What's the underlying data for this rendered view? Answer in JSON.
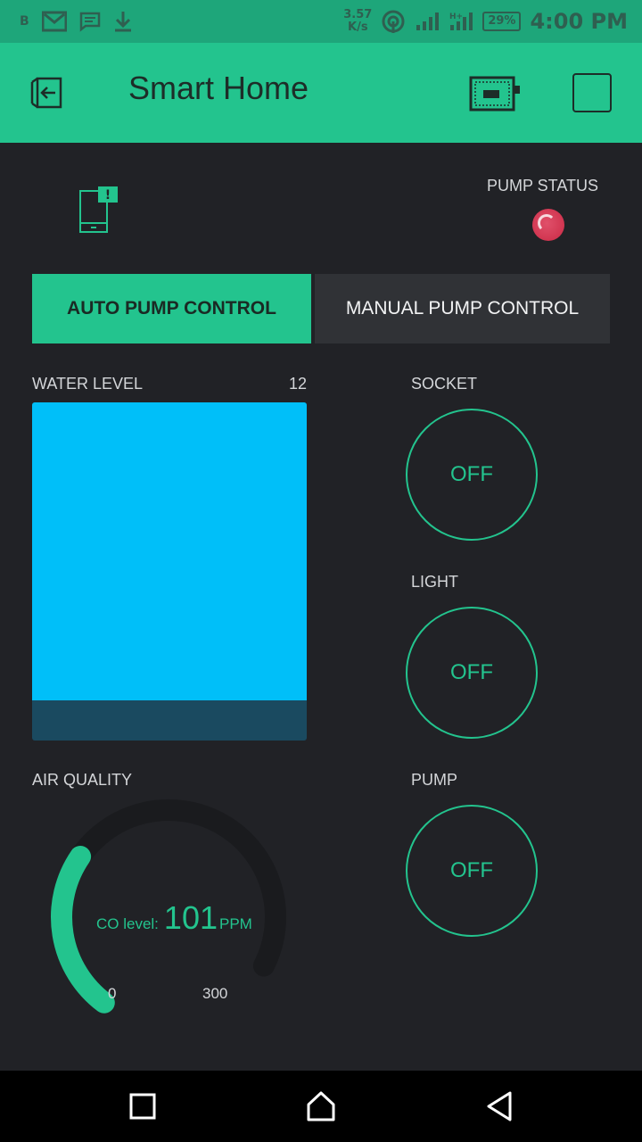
{
  "status_bar": {
    "left_letter": "B",
    "speed_value": "3.57",
    "speed_unit": "K/s",
    "battery": "29%",
    "time": "4:00 PM"
  },
  "header": {
    "title": "Smart Home"
  },
  "pump_status": {
    "label": "PUMP STATUS",
    "led_color": "#d13550"
  },
  "tabs": {
    "auto": "AUTO PUMP CONTROL",
    "manual": "MANUAL PUMP CONTROL",
    "selected": "auto"
  },
  "water_level": {
    "label": "WATER LEVEL",
    "value": "12",
    "fill_fraction": 0.88,
    "fill_color": "#00bff9"
  },
  "buttons": {
    "socket": {
      "label": "SOCKET",
      "state": "OFF"
    },
    "light": {
      "label": "LIGHT",
      "state": "OFF"
    },
    "pump": {
      "label": "PUMP",
      "state": "OFF"
    }
  },
  "air_quality": {
    "label": "AIR QUALITY",
    "prefix": "CO level:",
    "value": "101",
    "unit": "PPM",
    "min": "0",
    "max": "300",
    "value_number": 101,
    "min_number": 0,
    "max_number": 300
  },
  "colors": {
    "accent": "#23c48e",
    "background": "#212226"
  }
}
